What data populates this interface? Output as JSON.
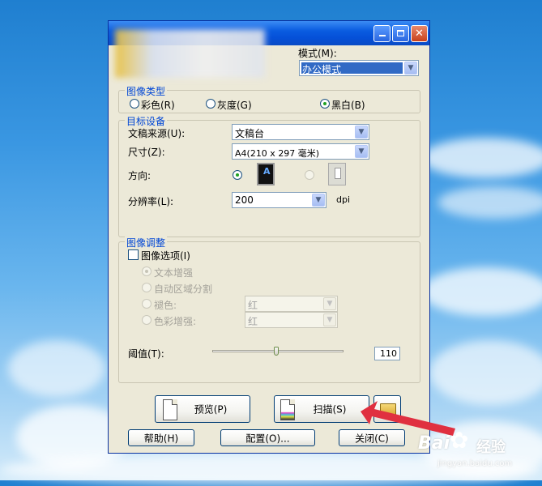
{
  "window": {
    "mode_label": "模式(M):",
    "mode_value": "办公模式"
  },
  "image_type": {
    "title": "图像类型",
    "color": "彩色(R)",
    "gray": "灰度(G)",
    "bw": "黑白(B)",
    "selected": "bw"
  },
  "target": {
    "title": "目标设备",
    "source_label": "文稿来源(U):",
    "source_value": "文稿台",
    "size_label": "尺寸(Z):",
    "size_value": "A4(210 x 297 毫米)",
    "orientation_label": "方向:",
    "resolution_label": "分辨率(L):",
    "resolution_value": "200",
    "resolution_unit": "dpi"
  },
  "adjust": {
    "title": "图像调整",
    "image_option": "图像选项(I)",
    "text_enhance": "文本增强",
    "auto_area": "自动区域分割",
    "dropout_label": "褪色:",
    "dropout_value": "红",
    "color_enhance_label": "色彩增强:",
    "color_enhance_value": "红",
    "threshold_label": "阈值(T):",
    "threshold_value": "110",
    "threshold_fraction": 0.49
  },
  "buttons": {
    "preview": "预览(P)",
    "scan": "扫描(S)",
    "help": "帮助(H)",
    "config": "配置(O)...",
    "close": "关闭(C)"
  },
  "watermark": {
    "brand": "Bai",
    "brand_suffix": "经验",
    "url": "jingyan.baidu.com"
  },
  "colors": {
    "accent": "#0046d5",
    "arrow": "#e03040"
  }
}
